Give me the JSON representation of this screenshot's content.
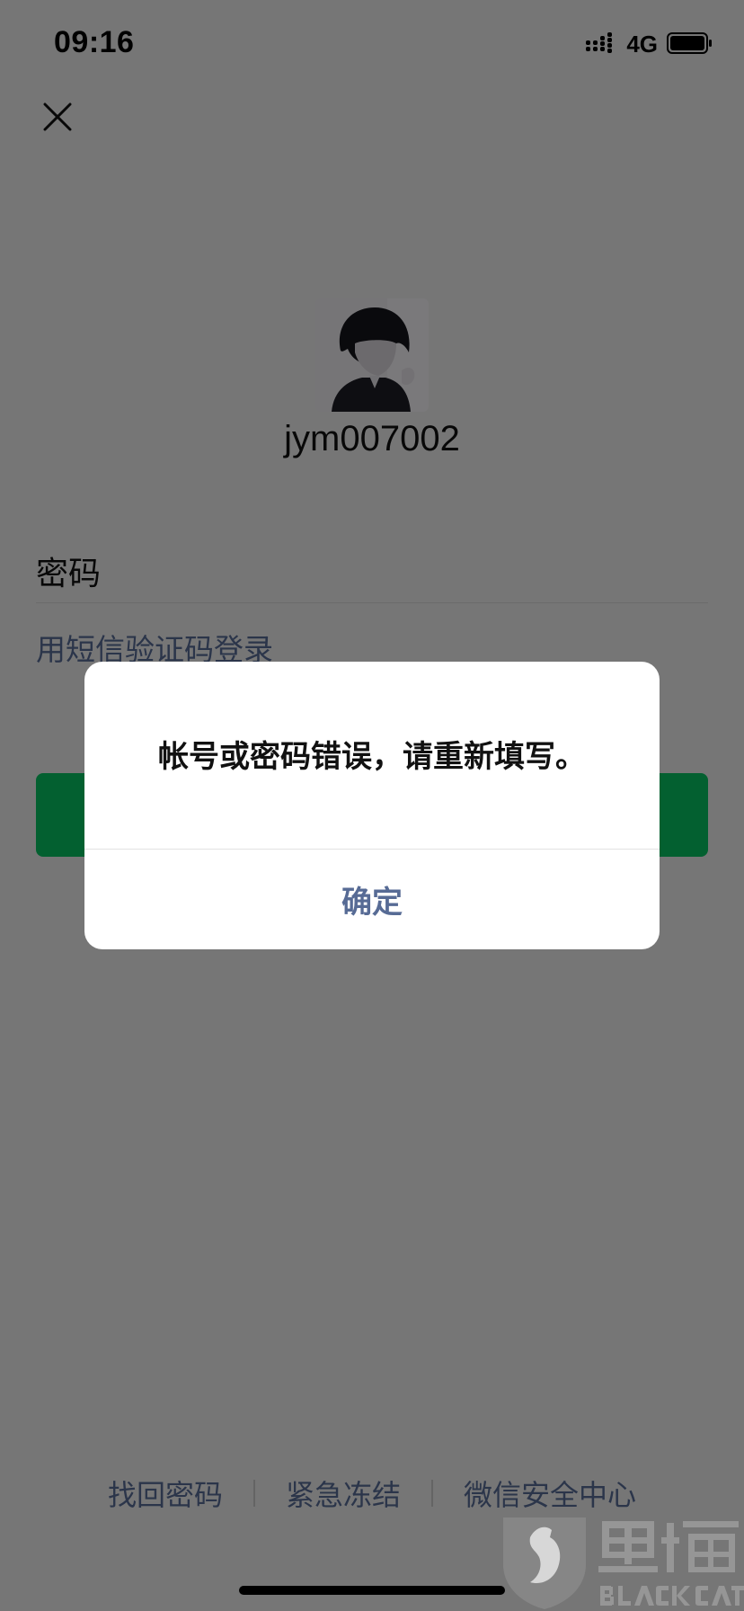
{
  "status_bar": {
    "time": "09:16",
    "network": "4G",
    "signal_icon": "cellular-signal-icon",
    "battery_icon": "battery-icon"
  },
  "header": {
    "close_icon": "close-icon"
  },
  "profile": {
    "username": "jym007002",
    "avatar_icon": "avatar-image"
  },
  "form": {
    "password_label": "密码",
    "sms_login_link": "用短信验证码登录"
  },
  "footer": {
    "links": [
      "找回密码",
      "紧急冻结",
      "微信安全中心"
    ]
  },
  "alert": {
    "message": "帐号或密码错误，请重新填写。",
    "confirm_label": "确定"
  },
  "watermark": {
    "text": "黑猫",
    "subtext": "BLACK CAT"
  },
  "colors": {
    "accent_green": "#07c160",
    "link_blue": "#576b95",
    "background": "#ededed"
  }
}
